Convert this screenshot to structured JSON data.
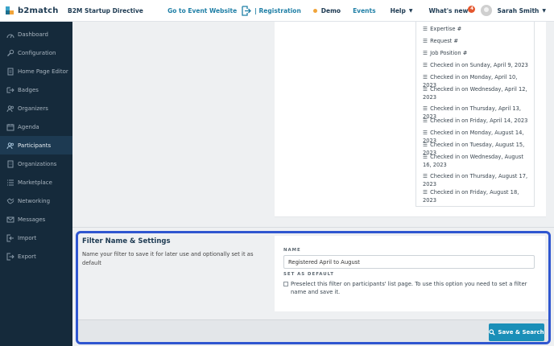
{
  "header": {
    "logo_text": "b2match",
    "event_name": "B2M Startup Directive",
    "event_website": "Go to Event Website",
    "registration": "| Registration",
    "demo": "Demo",
    "events": "Events",
    "help": "Help",
    "whats_new": "What's new",
    "whats_new_count": "4",
    "user_name": "Sarah Smith"
  },
  "sidebar": {
    "items": [
      {
        "label": "Dashboard",
        "icon": "dashboard-icon"
      },
      {
        "label": "Configuration",
        "icon": "wrench-icon"
      },
      {
        "label": "Home Page Editor",
        "icon": "page-icon"
      },
      {
        "label": "Badges",
        "icon": "badge-icon"
      },
      {
        "label": "Organizers",
        "icon": "people-icon"
      },
      {
        "label": "Agenda",
        "icon": "calendar-icon"
      },
      {
        "label": "Participants",
        "icon": "participants-icon"
      },
      {
        "label": "Organizations",
        "icon": "building-icon"
      },
      {
        "label": "Marketplace",
        "icon": "list-icon"
      },
      {
        "label": "Networking",
        "icon": "handshake-icon"
      },
      {
        "label": "Messages",
        "icon": "envelope-icon"
      },
      {
        "label": "Import",
        "icon": "import-icon"
      },
      {
        "label": "Export",
        "icon": "export-icon"
      }
    ]
  },
  "column_list": [
    "Expertise #",
    "Request #",
    "Job Position #",
    "Checked in on Sunday, April 9, 2023",
    "Checked in on Monday, April 10, 2023",
    "Checked in on Wednesday, April 12, 2023",
    "Checked in on Thursday, April 13, 2023",
    "Checked in on Friday, April 14, 2023",
    "Checked in on Monday, August 14, 2023",
    "Checked in on Tuesday, August 15, 2023",
    "Checked in on Wednesday, August 16, 2023",
    "Checked in on Thursday, August 17, 2023",
    "Checked in on Friday, August 18, 2023"
  ],
  "filter_settings": {
    "title": "Filter Name & Settings",
    "description": "Name your filter to save it for later use and optionally set it as default",
    "name_label": "NAME",
    "name_value": "Registered April to August",
    "default_label": "SET AS DEFAULT",
    "default_text": "Preselect this filter on participants' list page. To use this option you need to set a filter name and save it.",
    "default_checked": false,
    "save_button": "Save & Search"
  },
  "colors": {
    "sidebar_bg": "#152a3b",
    "accent": "#1a8fb8",
    "highlight_border": "#2f56d0"
  }
}
